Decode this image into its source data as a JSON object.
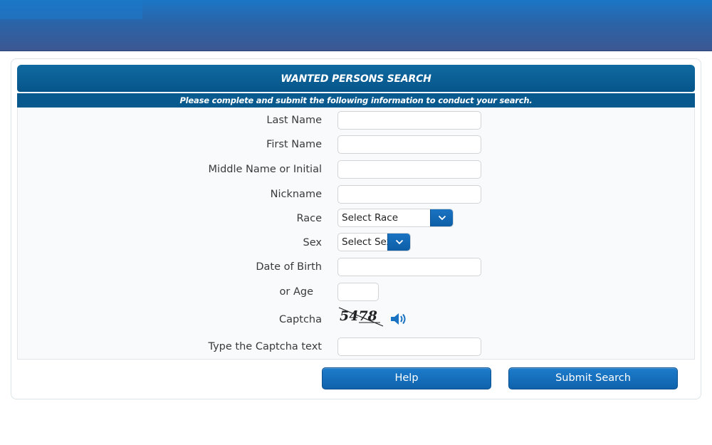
{
  "header": {
    "brand_color": "#1b76c6"
  },
  "form": {
    "title": "WANTED PERSONS SEARCH",
    "subtitle": "Please complete and submit the following information to conduct your search.",
    "fields": {
      "last_name": {
        "label": "Last Name",
        "value": "",
        "placeholder": ""
      },
      "first_name": {
        "label": "First Name",
        "value": "",
        "placeholder": ""
      },
      "middle_name": {
        "label": "Middle Name or Initial",
        "value": "",
        "placeholder": ""
      },
      "nickname": {
        "label": "Nickname",
        "value": "",
        "placeholder": ""
      },
      "race": {
        "label": "Race",
        "selected": "Select Race"
      },
      "sex": {
        "label": "Sex",
        "selected": "Select Sex"
      },
      "dob": {
        "label": "Date of Birth",
        "value": "",
        "placeholder": ""
      },
      "age": {
        "label": "or Age",
        "value": "",
        "placeholder": ""
      },
      "captcha": {
        "label": "Captcha",
        "code": "5478",
        "audio_icon": "speaker-icon"
      },
      "captcha_text": {
        "label": "Type the Captcha text",
        "value": "",
        "placeholder": ""
      }
    },
    "buttons": {
      "help": "Help",
      "submit": "Submit Search"
    }
  },
  "colors": {
    "title_bar": "#06558a",
    "button": "#0f62ab"
  }
}
